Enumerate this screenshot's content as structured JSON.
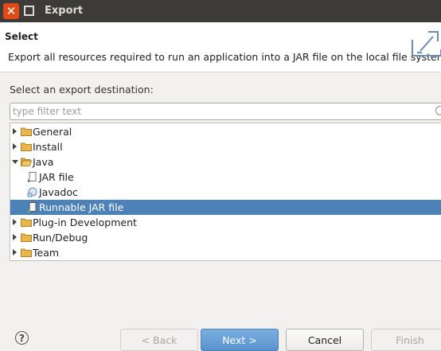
{
  "window": {
    "title": "Export"
  },
  "header": {
    "title": "Select",
    "description": "Export all resources required to run an application into a JAR file on the local file system."
  },
  "destination_label": "Select an export destination:",
  "filter": {
    "placeholder": "type filter text",
    "value": ""
  },
  "tree": {
    "rows": [
      {
        "label": "General",
        "icon": "folder-icon",
        "expanded": false
      },
      {
        "label": "Install",
        "icon": "folder-icon",
        "expanded": false
      },
      {
        "label": "Java",
        "icon": "folder-icon",
        "expanded": true
      },
      {
        "label": "JAR file",
        "icon": "jar-file-icon",
        "child": true
      },
      {
        "label": "Javadoc",
        "icon": "javadoc-icon",
        "child": true
      },
      {
        "label": "Runnable JAR file",
        "icon": "runnable-jar-icon",
        "child": true,
        "selected": true
      },
      {
        "label": "Plug-in Development",
        "icon": "folder-icon",
        "expanded": false
      },
      {
        "label": "Run/Debug",
        "icon": "folder-icon",
        "expanded": false
      },
      {
        "label": "Team",
        "icon": "folder-icon",
        "expanded": false
      }
    ]
  },
  "buttons": {
    "help": "?",
    "back": "< Back",
    "next": "Next >",
    "cancel": "Cancel",
    "finish": "Finish"
  },
  "colors": {
    "titlebar": "#3c3b37",
    "close": "#df4a16",
    "selection": "#4c82b8",
    "folder": "#e8b64c"
  }
}
